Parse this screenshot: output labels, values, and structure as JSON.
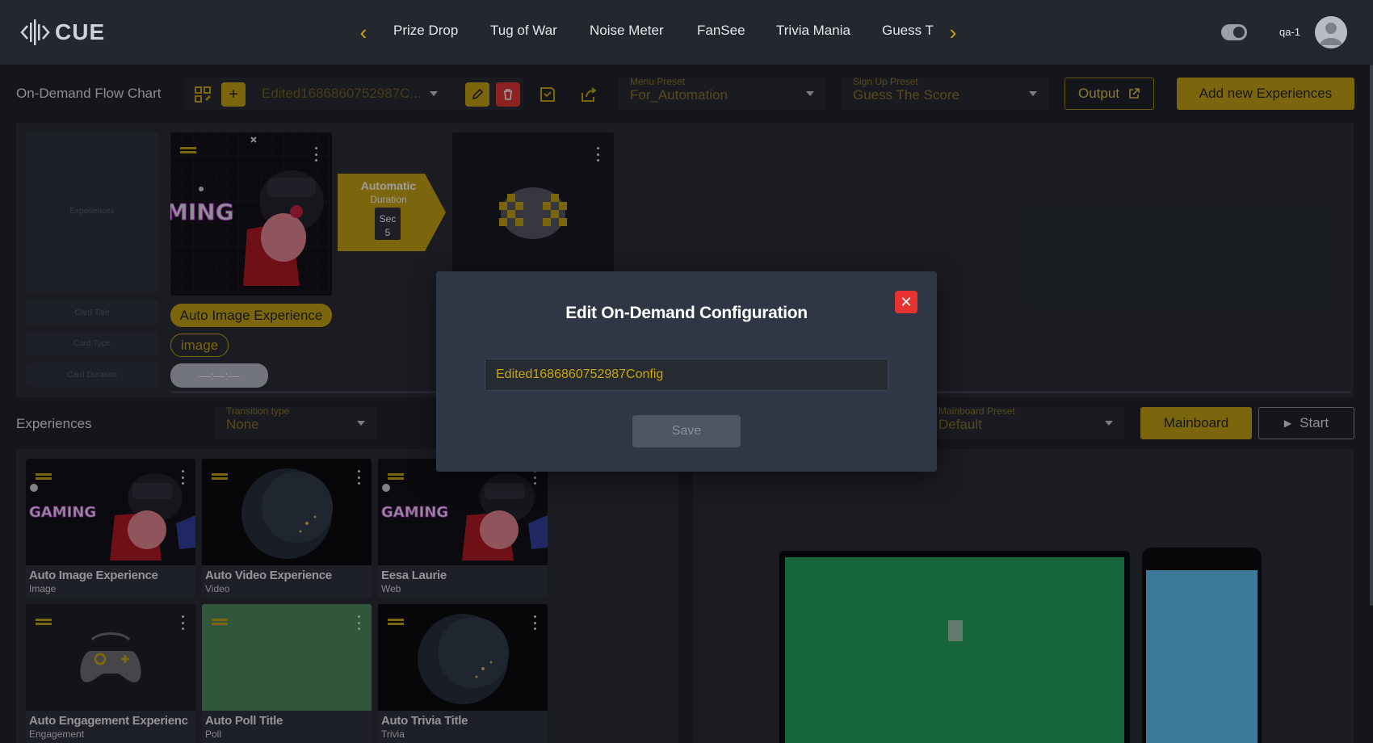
{
  "app": {
    "logo_text": "CUE",
    "username": "qa-1"
  },
  "nav": {
    "items": [
      "Prize Drop",
      "Tug of War",
      "Noise Meter",
      "FanSee",
      "Trivia Mania",
      "Guess T"
    ]
  },
  "flow": {
    "title": "On-Demand Flow Chart",
    "config_select": "Edited1686860752987C...",
    "menu_preset": {
      "label": "Menu Preset",
      "value": "For_Automation"
    },
    "signup_preset": {
      "label": "Sign Up Preset",
      "value": "Guess The Score"
    },
    "output_label": "Output",
    "add_label": "Add new Experiences",
    "placeholder": {
      "experiences": "Experiences",
      "card_title": "Card Title",
      "card_type": "Card Type",
      "card_duration": "Card Duration"
    },
    "card": {
      "title": "Auto Image Experience",
      "type": "image",
      "duration": "—:—:—"
    },
    "transition": {
      "mode": "Automatic",
      "duration_label": "Duration",
      "unit": "Sec",
      "seconds": "5"
    }
  },
  "experiences": {
    "title": "Experiences",
    "transition_type": {
      "label": "Transition type",
      "value": "None"
    },
    "mainboard_preset": {
      "label": "Mainboard Preset",
      "value": "Default"
    },
    "mainboard_label": "Mainboard",
    "start_label": "Start",
    "cards": [
      {
        "title": "Auto Image Experience",
        "type": "Image"
      },
      {
        "title": "Auto Video Experience",
        "type": "Video"
      },
      {
        "title": "Eesa Laurie",
        "type": "Web"
      },
      {
        "title": "Auto Engagement Experienc",
        "type": "Engagement"
      },
      {
        "title": "Auto Poll Title",
        "type": "Poll"
      },
      {
        "title": "Auto Trivia Title",
        "type": "Trivia"
      }
    ]
  },
  "modal": {
    "title": "Edit On-Demand Configuration",
    "input_value": "Edited1686860752987Config",
    "save_label": "Save"
  },
  "colors": {
    "accent": "#c9a40c",
    "danger": "#e5332f",
    "background": "#1c1f25",
    "panel": "#252930",
    "modal": "#2f3746"
  },
  "icons": {
    "nav_prev": "chevron-left-icon",
    "nav_next": "chevron-right-icon",
    "grid": "grid-icon",
    "add": "plus-icon",
    "edit": "pencil-icon",
    "delete": "trash-icon",
    "save": "save-icon",
    "share": "share-icon",
    "external": "external-link-icon",
    "play": "play-icon",
    "close": "close-icon"
  }
}
